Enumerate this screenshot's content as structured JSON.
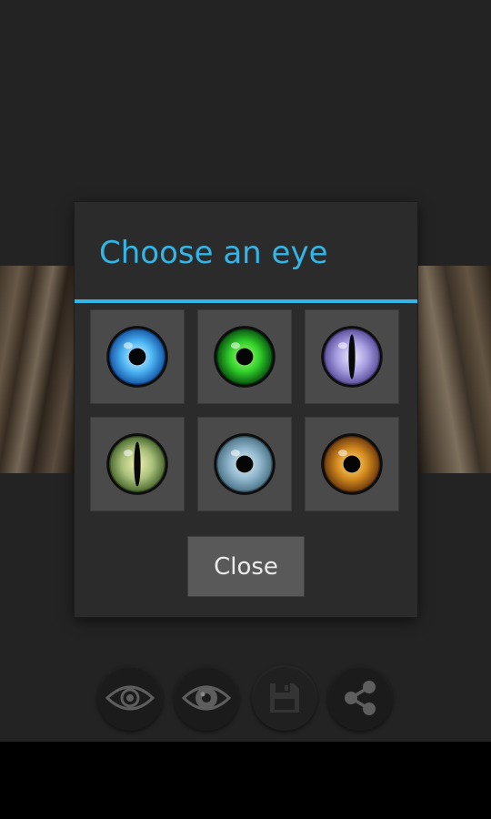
{
  "dialog": {
    "title": "Choose an eye",
    "close_label": "Close",
    "accent_color": "#33b5e5",
    "eyes": [
      {
        "icon": "blue-eye-icon",
        "iris": [
          "#e4f6ff",
          "#4bb4f2",
          "#1657a8"
        ]
      },
      {
        "icon": "green-eye-icon",
        "iris": [
          "#b6ff7c",
          "#2fce2a",
          "#0a5210"
        ]
      },
      {
        "icon": "violet-cat-eye-icon",
        "iris": [
          "#eee7ff",
          "#a79ee0",
          "#5b4e9c"
        ]
      },
      {
        "icon": "yellow-green-cat-eye-icon",
        "iris": [
          "#f2f2b4",
          "#a9c07b",
          "#49672e"
        ]
      },
      {
        "icon": "pale-blue-eye-icon",
        "iris": [
          "#e4f0f6",
          "#8fb6cc",
          "#4c7386"
        ]
      },
      {
        "icon": "amber-eye-icon",
        "iris": [
          "#ffe38a",
          "#d3891e",
          "#6c3a0e"
        ]
      }
    ]
  },
  "toolbar": {
    "buttons": [
      {
        "icon": "eye-outline-icon"
      },
      {
        "icon": "eye-filled-icon"
      },
      {
        "icon": "save-icon"
      },
      {
        "icon": "share-icon"
      }
    ]
  }
}
